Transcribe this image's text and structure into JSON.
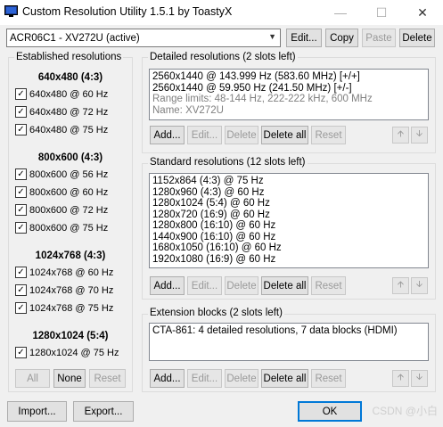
{
  "window": {
    "title": "Custom Resolution Utility 1.5.1 by ToastyX",
    "min_icon": "minimize-icon",
    "max_icon": "maximize-icon",
    "close_icon": "close-icon"
  },
  "toolbar": {
    "monitor": "ACR06C1 - XV272U (active)",
    "edit": "Edit...",
    "copy": "Copy",
    "paste": "Paste",
    "delete": "Delete"
  },
  "established": {
    "title": "Established resolutions",
    "groups": [
      {
        "heading": "640x480 (4:3)",
        "items": [
          "640x480 @ 60 Hz",
          "640x480 @ 72 Hz",
          "640x480 @ 75 Hz"
        ]
      },
      {
        "heading": "800x600 (4:3)",
        "items": [
          "800x600 @ 56 Hz",
          "800x600 @ 60 Hz",
          "800x600 @ 72 Hz",
          "800x600 @ 75 Hz"
        ]
      },
      {
        "heading": "1024x768 (4:3)",
        "items": [
          "1024x768 @ 60 Hz",
          "1024x768 @ 70 Hz",
          "1024x768 @ 75 Hz"
        ]
      },
      {
        "heading": "1280x1024 (5:4)",
        "items": [
          "1280x1024 @ 75 Hz"
        ]
      }
    ],
    "all": "All",
    "none": "None",
    "reset": "Reset"
  },
  "detailed": {
    "title": "Detailed resolutions (2 slots left)",
    "lines": [
      "2560x1440 @ 143.999 Hz (583.60 MHz) [+/+]",
      "2560x1440 @ 59.950 Hz (241.50 MHz) [+/-]"
    ],
    "gray_lines": [
      "Range limits: 48-144 Hz, 222-222 kHz, 600 MHz",
      "Name: XV272U"
    ]
  },
  "standard": {
    "title": "Standard resolutions (12 slots left)",
    "lines": [
      "1152x864 (4:3) @ 75 Hz",
      "1280x960 (4:3) @ 60 Hz",
      "1280x1024 (5:4) @ 60 Hz",
      "1280x720 (16:9) @ 60 Hz",
      "1280x800 (16:10) @ 60 Hz",
      "1440x900 (16:10) @ 60 Hz",
      "1680x1050 (16:10) @ 60 Hz",
      "1920x1080 (16:9) @ 60 Hz"
    ]
  },
  "extension": {
    "title": "Extension blocks (2 slots left)",
    "lines": [
      "CTA-861: 4 detailed resolutions, 7 data blocks (HDMI)"
    ]
  },
  "section_buttons": {
    "add": "Add...",
    "edit": "Edit...",
    "delete": "Delete",
    "delete_all": "Delete all",
    "reset": "Reset"
  },
  "footer": {
    "import": "Import...",
    "export": "Export...",
    "ok": "OK",
    "watermark": "CSDN @小白"
  }
}
